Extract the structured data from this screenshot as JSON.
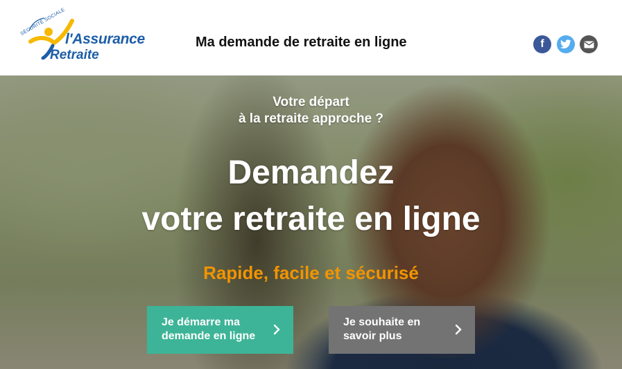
{
  "header": {
    "logo": {
      "sub_text": "SÉCURITÉ SOCIALE",
      "line1": "l'Assurance",
      "line2": "Retraite"
    },
    "page_title": "Ma demande de retraite en ligne",
    "social": [
      {
        "name": "facebook-icon",
        "glyph": "f"
      },
      {
        "name": "twitter-icon",
        "glyph": ""
      },
      {
        "name": "mail-icon",
        "glyph": ""
      }
    ]
  },
  "hero": {
    "intro_line1": "Votre départ",
    "intro_line2": "à la retraite approche ?",
    "headline_line1": "Demandez",
    "headline_line2": "votre retraite en ligne",
    "tagline": "Rapide, facile et sécurisé",
    "buttons": {
      "start": {
        "label": "Je démarre ma demande en ligne",
        "color": "#3db497"
      },
      "info": {
        "label": "Je souhaite en savoir plus",
        "color": "#737373"
      }
    }
  },
  "colors": {
    "brand_blue": "#1d5ea8",
    "accent_orange": "#f29400"
  }
}
